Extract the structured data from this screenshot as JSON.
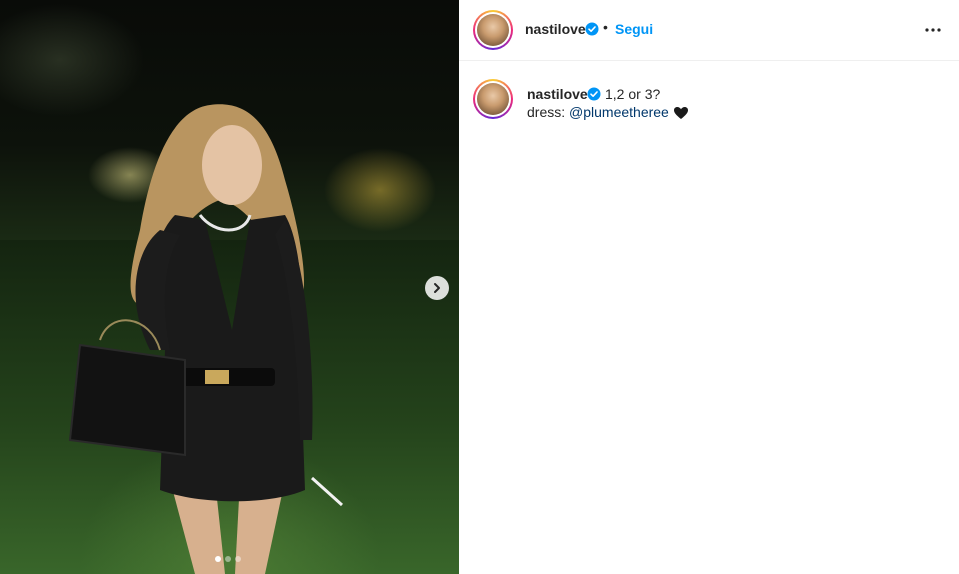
{
  "post": {
    "username": "nastilove",
    "follow_label": "Segui",
    "bullet": "•",
    "caption_text": "1,2 or 3?",
    "caption_line2_prefix": "dress: ",
    "caption_mention": "@plumeetheree",
    "carousel": {
      "total": 3,
      "active_index": 0
    }
  },
  "colors": {
    "follow_blue": "#0095f6",
    "verified_blue": "#0095f6",
    "mention_color": "#00376b"
  },
  "icons": {
    "verified": "verified-badge-icon",
    "more": "more-options-icon",
    "next": "chevron-right-icon",
    "heart": "black-heart-icon"
  }
}
